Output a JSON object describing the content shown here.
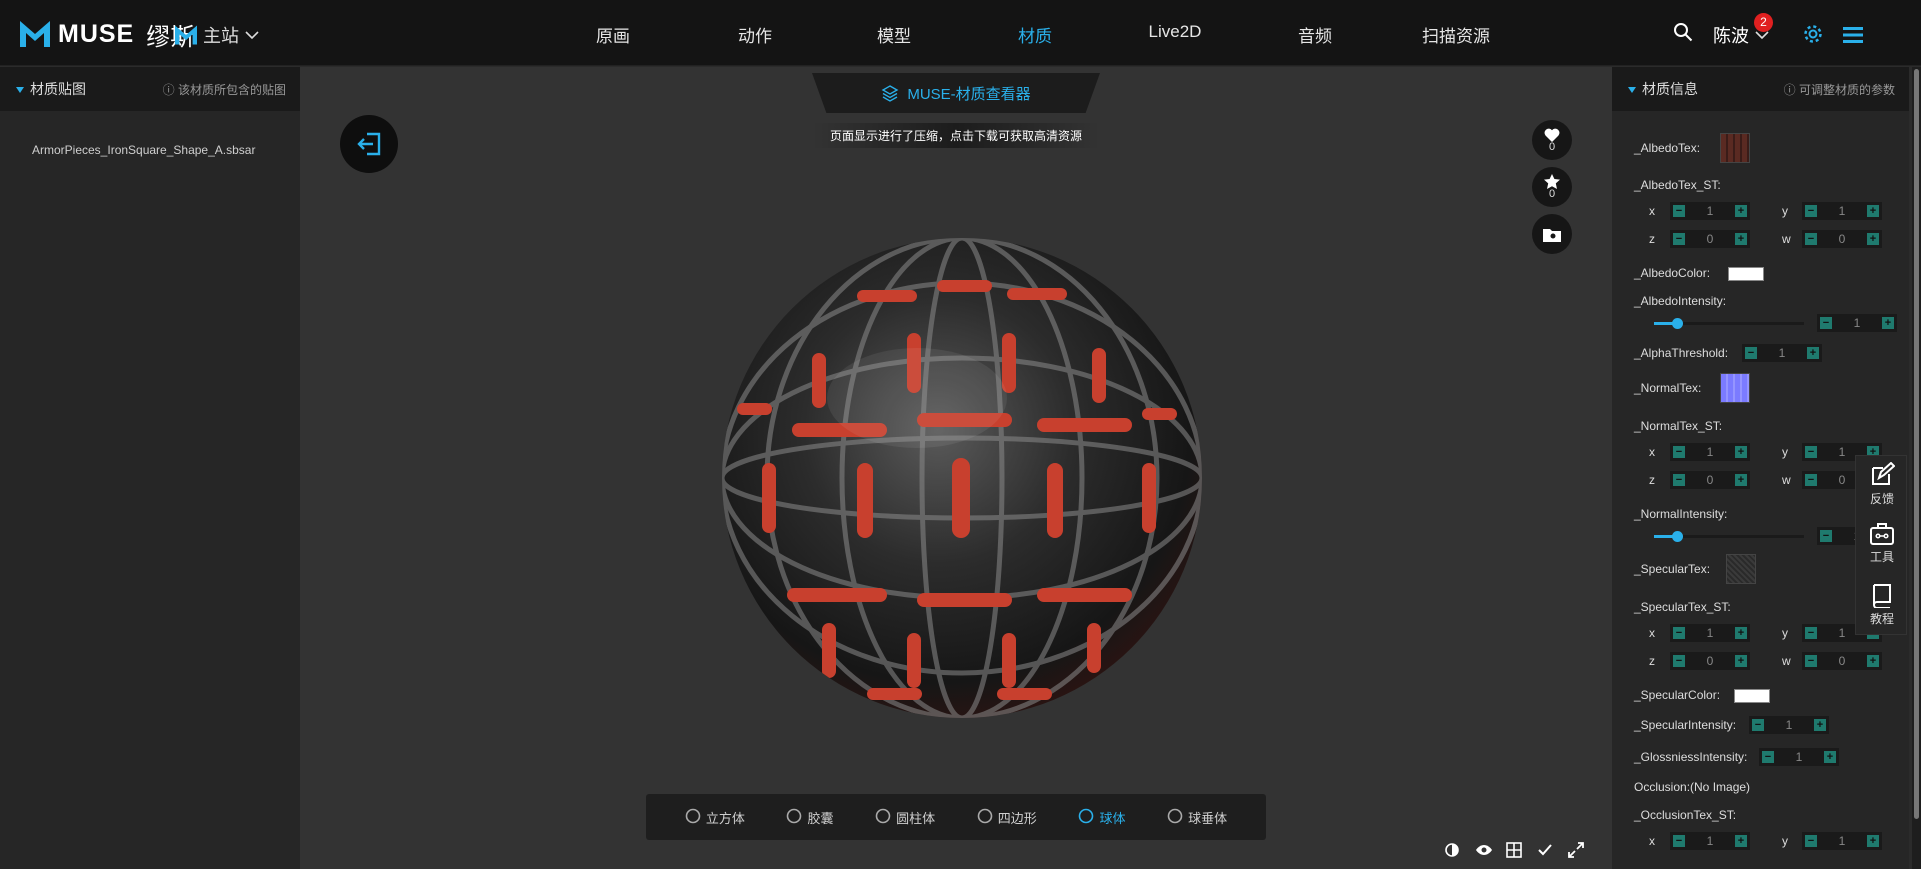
{
  "header": {
    "logo_text": "MUSE",
    "logo_cn": "缪斯",
    "site_label": "主站",
    "nav": [
      {
        "label": "原画",
        "active": false
      },
      {
        "label": "动作",
        "active": false
      },
      {
        "label": "模型",
        "active": false
      },
      {
        "label": "材质",
        "active": true
      },
      {
        "label": "Live2D",
        "active": false
      },
      {
        "label": "音频",
        "active": false
      },
      {
        "label": "扫描资源",
        "active": false
      }
    ],
    "user_name": "陈波",
    "notification_count": "2",
    "accent_color": "#2ab0ea"
  },
  "left_panel": {
    "title": "材质贴图",
    "hint": "ⓘ 该材质所包含的贴图",
    "file": "ArmorPieces_IronSquare_Shape_A.sbsar"
  },
  "viewer": {
    "tab_title": "MUSE-材质查看器",
    "notice": "页面显示进行了压缩，点击下载可获取高清资源",
    "likes": "0",
    "favorites": "0",
    "shapes": [
      {
        "label": "立方体",
        "icon": "cube-icon",
        "active": false
      },
      {
        "label": "胶囊",
        "icon": "capsule-icon",
        "active": false
      },
      {
        "label": "圆柱体",
        "icon": "cylinder-icon",
        "active": false
      },
      {
        "label": "四边形",
        "icon": "quad-icon",
        "active": false
      },
      {
        "label": "球体",
        "icon": "sphere-icon",
        "active": true
      },
      {
        "label": "球垂体",
        "icon": "sphere-alt-icon",
        "active": false
      }
    ]
  },
  "right_panel": {
    "title": "材质信息",
    "hint": "ⓘ 可调整材质的参数",
    "albedo_tex": "_AlbedoTex:",
    "albedo_tex_st": "_AlbedoTex_ST:",
    "albedo_st": {
      "x": "1",
      "y": "1",
      "z": "0",
      "w": "0"
    },
    "albedo_color": "_AlbedoColor:",
    "albedo_intensity": "_AlbedoIntensity:",
    "albedo_intensity_value": "1",
    "albedo_intensity_level": 0.15,
    "alpha_threshold": "_AlphaThreshold:",
    "alpha_threshold_value": "1",
    "normal_tex": "_NormalTex:",
    "normal_tex_st": "_NormalTex_ST:",
    "normal_st": {
      "x": "1",
      "y": "1",
      "z": "0",
      "w": "0"
    },
    "normal_intensity": "_NormalIntensity:",
    "normal_intensity_value": "1",
    "normal_intensity_level": 0.15,
    "specular_tex": "_SpecularTex:",
    "specular_tex_st": "_SpecularTex_ST:",
    "specular_st": {
      "x": "1",
      "y": "1",
      "z": "0",
      "w": "0"
    },
    "specular_color": "_SpecularColor:",
    "specular_intensity": "_SpecularIntensity:",
    "specular_intensity_value": "1",
    "glossiness_intensity": "_GlossniessIntensity:",
    "glossiness_intensity_value": "1",
    "occlusion": "Occlusion:(No Image)",
    "occlusion_tex_st": "_OcclusionTex_ST:",
    "occlusion_st": {
      "x": "1",
      "y": "1"
    },
    "axis": {
      "x": "x",
      "y": "y",
      "z": "z",
      "w": "w"
    }
  },
  "float_bar": {
    "feedback": "反馈",
    "tools": "工具",
    "tutorial": "教程"
  }
}
